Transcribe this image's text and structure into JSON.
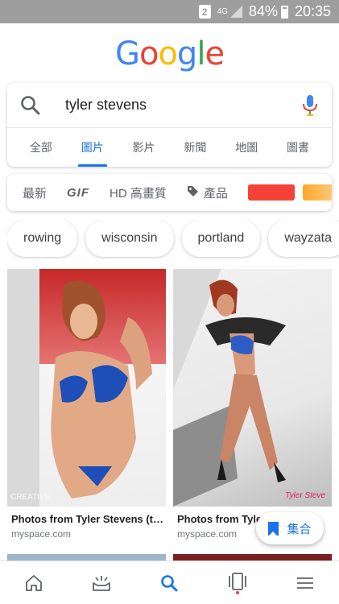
{
  "status_bar": {
    "sim": "2",
    "network": "4G",
    "battery": "84%",
    "time": "20:35"
  },
  "logo": [
    "G",
    "o",
    "o",
    "g",
    "l",
    "e"
  ],
  "search": {
    "query": "tyler stevens",
    "search_icon": "search-icon",
    "mic_icon": "mic-icon"
  },
  "tabs": [
    {
      "label": "全部",
      "active": false
    },
    {
      "label": "圖片",
      "active": true
    },
    {
      "label": "影片",
      "active": false
    },
    {
      "label": "新聞",
      "active": false
    },
    {
      "label": "地圖",
      "active": false
    },
    {
      "label": "圖書",
      "active": false
    }
  ],
  "filters": {
    "latest": "最新",
    "gif": "GIF",
    "hd": "HD 高畫質",
    "products": "產品",
    "swatch_colors": [
      "#f44336",
      "#ffa726"
    ]
  },
  "chips": [
    "rowing",
    "wisconsin",
    "portland",
    "wayzata"
  ],
  "results": [
    {
      "title": "Photos from Tyler Stevens (ty...",
      "source": "myspace.com",
      "watermark": "CREATIVE"
    },
    {
      "title": "Photos from Tyle",
      "source": "myspace.com",
      "watermark": "Tyler Steve"
    }
  ],
  "collection_button": {
    "label": "集合",
    "icon": "bookmark-icon"
  },
  "bottom_nav": [
    {
      "icon": "home-icon"
    },
    {
      "icon": "updates-icon"
    },
    {
      "icon": "search-icon",
      "active": true
    },
    {
      "icon": "recent-tabs-icon"
    },
    {
      "icon": "menu-icon"
    }
  ],
  "colors": {
    "accent": "#1a73e8",
    "status_bar": "#9e9e9e"
  }
}
